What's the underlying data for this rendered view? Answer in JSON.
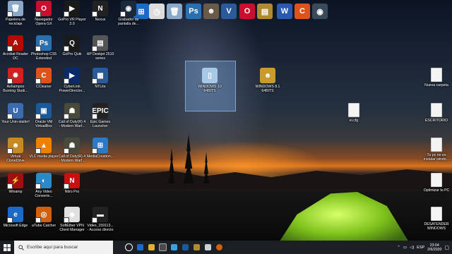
{
  "desktop_icons": [
    {
      "name": "recycle-bin-icon",
      "label": "Papelera de\nreciclaje",
      "color": "#8aa8c8",
      "glyph": "🗑"
    },
    {
      "name": "opera-gx-icon",
      "label": "Navegador\nOpera GX",
      "color": "#c8102e",
      "glyph": "O"
    },
    {
      "name": "gopro-vr-player-icon",
      "label": "GoPro VR Player\n3.0",
      "color": "#1a1a1a",
      "glyph": "▶"
    },
    {
      "name": "nexus-icon",
      "label": "Nexus",
      "color": "#222",
      "glyph": "N"
    },
    {
      "name": "screen-recorder-icon",
      "label": "Grabador de\npantalla de...",
      "color": "#1a2a3a",
      "glyph": "◉"
    },
    {
      "name": "acrobat-reader-icon",
      "label": "Acrobat Reader\nDC",
      "color": "#b30b00",
      "glyph": "A"
    },
    {
      "name": "photoshop-cs5-icon",
      "label": "Photoshop CS5\nExtended",
      "color": "#2a6fb0",
      "glyph": "Ps"
    },
    {
      "name": "gopro-quik-icon",
      "label": "GoPro Quik",
      "color": "#1a1a1a",
      "glyph": "Q"
    },
    {
      "name": "hp-deskjet-icon",
      "label": "HP Deskjet 2510\nseries",
      "color": "#555",
      "glyph": "▤"
    },
    {
      "name": "ashampoo-icon",
      "label": "Ashampoo\nBurning Studi...",
      "color": "#d02020",
      "glyph": "✹"
    },
    {
      "name": "ccleaner-icon",
      "label": "CCleaner",
      "color": "#e0521c",
      "glyph": "C"
    },
    {
      "name": "cyberlink-icon",
      "label": "CyberLink\nPowerDirector...",
      "color": "#0a2a6a",
      "glyph": "▶"
    },
    {
      "name": "ntlite-icon",
      "label": "NTLite",
      "color": "#2a5a9a",
      "glyph": "▦"
    },
    {
      "name": "your-uninstaller-icon",
      "label": "Your Unin-staller!",
      "color": "#3a6ab0",
      "glyph": "U"
    },
    {
      "name": "virtualbox-icon",
      "label": "Oracle VM\nVirtualBox",
      "color": "#1a5a9a",
      "glyph": "▣"
    },
    {
      "name": "cod4-icon-1",
      "label": "Call of Duty(R) 4\n- Modern Warf...",
      "color": "#4a4a3a",
      "glyph": "☗"
    },
    {
      "name": "epic-games-icon",
      "label": "Epic Games\nLauncher",
      "color": "#222",
      "glyph": "EPIC"
    },
    {
      "name": "virtual-clonedrive-icon",
      "label": "Virtual\nCloneDrive",
      "color": "#c88a20",
      "glyph": "☻"
    },
    {
      "name": "vlc-icon",
      "label": "VLC media player",
      "color": "#f08000",
      "glyph": "▲"
    },
    {
      "name": "cod4-icon-2",
      "label": "Call of Duty(R) 4\n- Modern Warf...",
      "color": "#4a4a3a",
      "glyph": "☗"
    },
    {
      "name": "media-creation-icon",
      "label": "MediaCreation...",
      "color": "#2a7ac8",
      "glyph": "⊞"
    },
    {
      "name": "winamp-icon",
      "label": "Winamp",
      "color": "#a01010",
      "glyph": "⚡"
    },
    {
      "name": "any-video-converter-icon",
      "label": "Any Video\nConverte...",
      "color": "#2a8ac8",
      "glyph": "◐"
    },
    {
      "name": "nitro-pro-icon",
      "label": "Nitro Pro",
      "color": "#c81010",
      "glyph": "N"
    },
    {
      "name": "microsoft-edge-icon",
      "label": "Microsoft Edge",
      "color": "#1a6ac8",
      "glyph": "e"
    },
    {
      "name": "atube-catcher-icon",
      "label": "aTube Catcher",
      "color": "#d06010",
      "glyph": "◎"
    },
    {
      "name": "softether-vpn-icon",
      "label": "SoftEther VPN\nClient Manager",
      "color": "#e0e0e0",
      "glyph": "◆"
    },
    {
      "name": "video-file-icon",
      "label": "Video_159113...\n- Acceso directo",
      "color": "#222",
      "glyph": "▬"
    },
    {
      "name": "windows-folder-selected-icon",
      "label": "WINDOWS 10\n64BITS",
      "color": "#a8c8e8",
      "glyph": "▯"
    },
    {
      "name": "windows81-iso-icon",
      "label": "WINDOWS 8.1\n64BITS",
      "color": "#c89a30",
      "glyph": "☻"
    },
    {
      "name": "ei-cfg-file-icon",
      "label": "ei.cfg",
      "color": "#f4f4f4",
      "glyph": ""
    },
    {
      "name": "nueva-carpeta-icon",
      "label": "Nueva carpeta",
      "color": "#f4f4f4",
      "glyph": ""
    },
    {
      "name": "escritorio-icon",
      "label": "ESCRITORIO",
      "color": "#f4f4f4",
      "glyph": ""
    },
    {
      "name": "tu-pc-no-es-icon",
      "label": "Tu pc no es\ninstalar windo...",
      "color": "#f4f4f4",
      "glyph": ""
    },
    {
      "name": "optimizar-tu-pc-icon",
      "label": "Optimizar tu PC",
      "color": "#f4f4f4",
      "glyph": ""
    },
    {
      "name": "desatender-windows-icon",
      "label": "DESATENDER\nWINDOWS",
      "color": "#f4f4f4",
      "glyph": ""
    }
  ],
  "top_bar_icons": [
    {
      "name": "app-top-1-icon",
      "color": "#1a2a3a",
      "glyph": "◉"
    },
    {
      "name": "windows-logo-icon",
      "color": "#1a6ac8",
      "glyph": "⊞"
    },
    {
      "name": "clock-app-icon",
      "color": "#dcdcdc",
      "glyph": "◷"
    },
    {
      "name": "trash-app-icon",
      "color": "#8aa8c8",
      "glyph": "🗑"
    },
    {
      "name": "photoshop-top-icon",
      "color": "#2a6fb0",
      "glyph": "Ps"
    },
    {
      "name": "gimp-icon",
      "color": "#6a5a4a",
      "glyph": "☻"
    },
    {
      "name": "vu-app-icon",
      "color": "#2a5a9a",
      "glyph": "V"
    },
    {
      "name": "opera-top-icon",
      "color": "#c8102e",
      "glyph": "O"
    },
    {
      "name": "winrar-icon",
      "color": "#b08a30",
      "glyph": "▤"
    },
    {
      "name": "word-icon",
      "color": "#2a5ab0",
      "glyph": "W"
    },
    {
      "name": "ccleaner-top-icon",
      "color": "#e0521c",
      "glyph": "C"
    },
    {
      "name": "camera-app-icon",
      "color": "#3a4a5a",
      "glyph": "◉"
    }
  ],
  "taskbar": {
    "search_placeholder": "Escribe aquí para buscar",
    "language": "ESP",
    "time": "23:04",
    "date": "2/6/2020"
  }
}
